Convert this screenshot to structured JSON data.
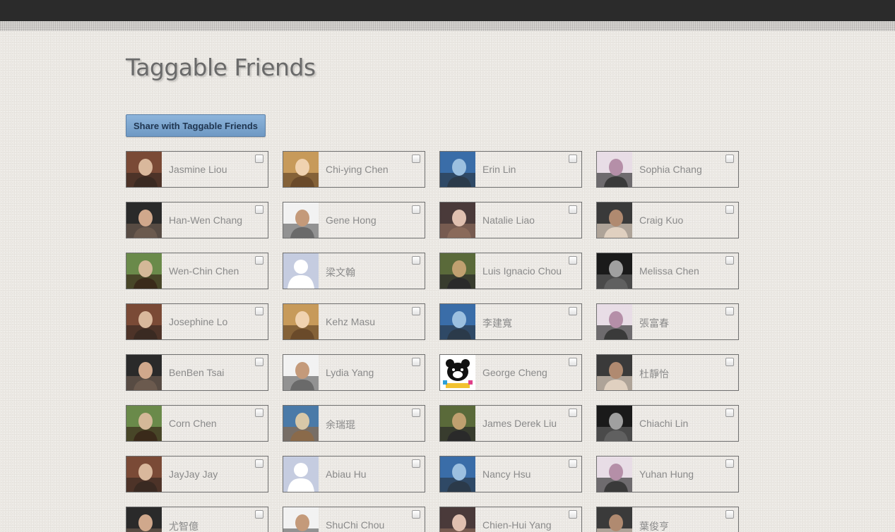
{
  "page": {
    "title": "Taggable Friends",
    "share_button_label": "Share with Taggable Friends"
  },
  "colors": {
    "topbar": "#2b2b2b",
    "background": "#ece9e4",
    "button": "#7fa7d0",
    "card_border": "#6f6f6f",
    "name_text": "#8a8a8a"
  },
  "friends": [
    {
      "name": "Jasmine Liou",
      "avatar": "photo-woman-icon"
    },
    {
      "name": "Chi-ying Chen",
      "avatar": "photo-woman-icon"
    },
    {
      "name": "Erin Lin",
      "avatar": "photo-sea-icon"
    },
    {
      "name": "Sophia Chang",
      "avatar": "photo-tree-icon"
    },
    {
      "name": "Han-Wen Chang",
      "avatar": "photo-man-icon"
    },
    {
      "name": "Gene Hong",
      "avatar": "photo-man-icon"
    },
    {
      "name": "Natalie Liao",
      "avatar": "photo-woman-icon"
    },
    {
      "name": "Craig Kuo",
      "avatar": "photo-couple-icon"
    },
    {
      "name": "Wen-Chin Chen",
      "avatar": "photo-woman-icon"
    },
    {
      "name": "梁文翰",
      "avatar": "default-avatar-icon"
    },
    {
      "name": "Luis Ignacio Chou",
      "avatar": "photo-beach-icon"
    },
    {
      "name": "Melissa Chen",
      "avatar": "photo-woman-icon"
    },
    {
      "name": "Josephine Lo",
      "avatar": "photo-woman-icon"
    },
    {
      "name": "Kehz Masu",
      "avatar": "photo-man-icon"
    },
    {
      "name": "李建寬",
      "avatar": "photo-man-icon"
    },
    {
      "name": "張富春",
      "avatar": "photo-woman-icon"
    },
    {
      "name": "BenBen Tsai",
      "avatar": "photo-woman-icon"
    },
    {
      "name": "Lydia Yang",
      "avatar": "photo-woman-icon"
    },
    {
      "name": "George Cheng",
      "avatar": "bear-cartoon-icon"
    },
    {
      "name": "杜靜怡",
      "avatar": "photo-woman-icon"
    },
    {
      "name": "Corn Chen",
      "avatar": "photo-garden-icon"
    },
    {
      "name": "余瑞琨",
      "avatar": "photo-woman-icon"
    },
    {
      "name": "James Derek Liu",
      "avatar": "photo-field-icon"
    },
    {
      "name": "Chiachi Lin",
      "avatar": "photo-window-icon"
    },
    {
      "name": "JayJay Jay",
      "avatar": "photo-man-icon"
    },
    {
      "name": "Abiau Hu",
      "avatar": "default-avatar-icon"
    },
    {
      "name": "Nancy Hsu",
      "avatar": "photo-woman-icon"
    },
    {
      "name": "Yuhan Hung",
      "avatar": "photo-woman-icon"
    },
    {
      "name": "尤智億",
      "avatar": "photo-woman-icon"
    },
    {
      "name": "ShuChi Chou",
      "avatar": "photo-city-icon"
    },
    {
      "name": "Chien-Hui Yang",
      "avatar": "photo-woman-icon"
    },
    {
      "name": "葉俊亨",
      "avatar": "photo-man-icon"
    }
  ]
}
